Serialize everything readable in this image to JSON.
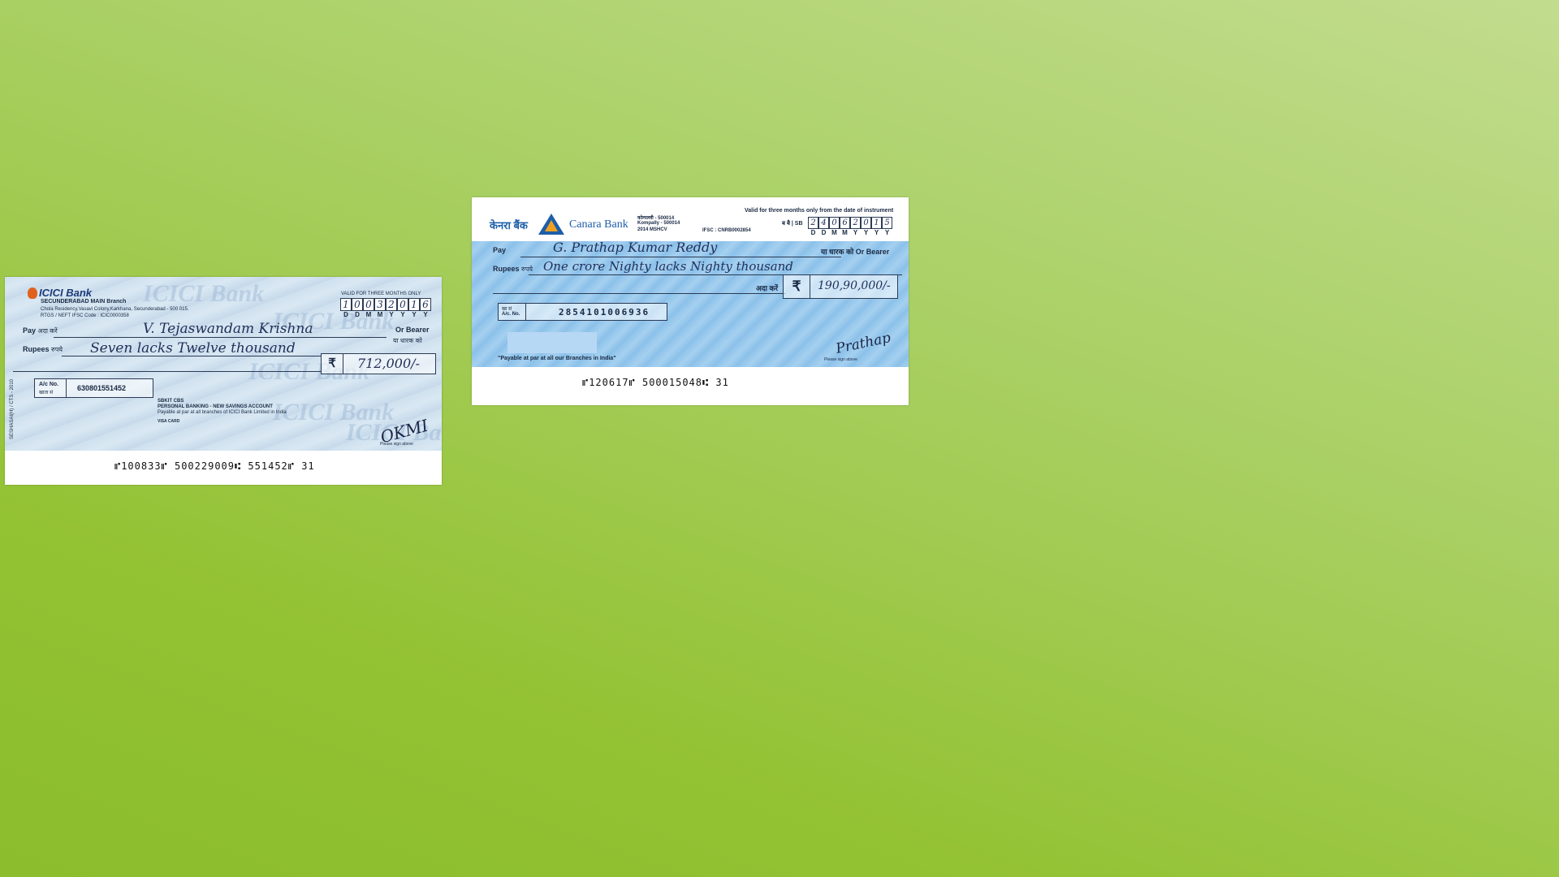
{
  "icici": {
    "bank_name": "ICICI Bank",
    "watermark": "ICICI Bank",
    "branch": "SECUNDERABAD MAIN Branch",
    "address": "Chola Residency,Vasavi Colony,Karkhana, Secunderabad - 500 015.",
    "ifsc_line": "RTGS / NEFT IFSC Code : ICIC0000358",
    "validity": "VALID FOR THREE MONTHS ONLY",
    "date_digits": [
      "1",
      "0",
      "0",
      "3",
      "2",
      "0",
      "1",
      "6"
    ],
    "date_format": [
      "D",
      "D",
      "M",
      "M",
      "Y",
      "Y",
      "Y",
      "Y"
    ],
    "pay_label": "Pay",
    "pay_label_hindi": "अदा करें",
    "payee": "V. Tejaswandam Krishna",
    "or_bearer": "Or Bearer",
    "or_bearer_hindi": "या धारक को",
    "rupees_label": "Rupees",
    "rupees_label_hindi": "रुपये",
    "amount_words": "Seven lacks Twelve thousand",
    "rupee_symbol": "₹",
    "amount_figure": "712,000/-",
    "ac_label": "A/c No.",
    "ac_label_hindi": "खाता सं",
    "account_number": "630801551452",
    "account_type_codes": "SBKIT          CBS",
    "account_type": "PERSONAL BANKING - NEW SAVINGS ACCOUNT",
    "payable_note": "Payable at par at all branches of ICICI Bank Limited in India",
    "card_note": "VISA CARD",
    "signature": "OKMI",
    "sign_note": "Please sign above",
    "side_text": "SESHASAI(H) / CTS - 2010",
    "micr": "⑈100833⑈  500229009⑆  551452⑈  31"
  },
  "canara": {
    "bank_name_hindi": "केनरा बैंक",
    "bank_name": "Canara Bank",
    "branch_code": "कोम्पल्ली - 500014",
    "branch": "Kompally - 500014",
    "branch_extra": "2014 MSHCV",
    "ifsc": "IFSC : CNRB0002854",
    "validity": "Valid for three months only from the date of instrument",
    "sb_label": "ब बै | SB",
    "date_digits": [
      "2",
      "4",
      "0",
      "6",
      "2",
      "0",
      "1",
      "5"
    ],
    "date_format": [
      "D",
      "D",
      "M",
      "M",
      "Y",
      "Y",
      "Y",
      "Y"
    ],
    "pay_label": "Pay",
    "payee": "G. Prathap Kumar Reddy",
    "or_bearer": "या धारक को Or Bearer",
    "rupees_label": "Rupees",
    "rupees_label_hindi": "रुपये",
    "amount_words": "One crore Nighty lacks Nighty thousand",
    "ada_karen": "अदा करें",
    "rupee_symbol": "₹",
    "amount_figure": "190,90,000/-",
    "ac_label_hindi": "खा सं",
    "ac_label": "A/c. No.",
    "account_number": "2854101006936",
    "payable_note": "\"Payable at par at all our Branches in India\"",
    "signature": "Prathap",
    "sign_note": "Please sign above",
    "micr": "⑈120617⑈  500015048⑆    31"
  }
}
